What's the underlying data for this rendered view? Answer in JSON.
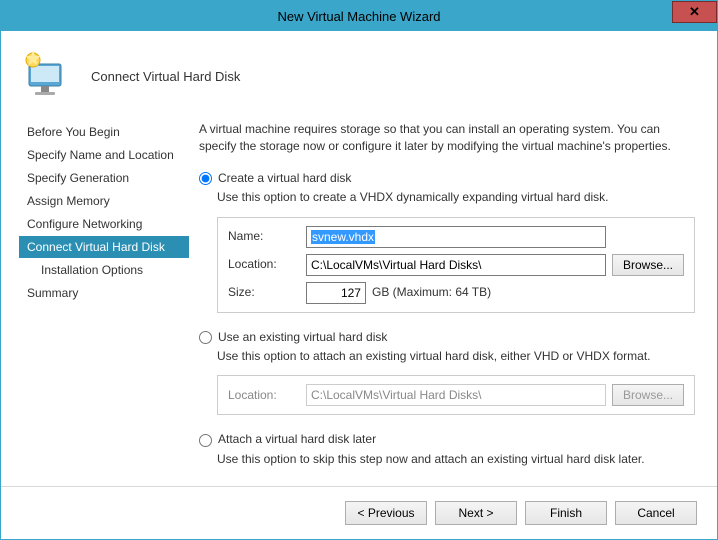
{
  "window": {
    "title": "New Virtual Machine Wizard"
  },
  "header": {
    "title": "Connect Virtual Hard Disk"
  },
  "sidebar": {
    "items": [
      {
        "label": "Before You Begin"
      },
      {
        "label": "Specify Name and Location"
      },
      {
        "label": "Specify Generation"
      },
      {
        "label": "Assign Memory"
      },
      {
        "label": "Configure Networking"
      },
      {
        "label": "Connect Virtual Hard Disk"
      },
      {
        "label": "Installation Options"
      },
      {
        "label": "Summary"
      }
    ]
  },
  "main": {
    "description": "A virtual machine requires storage so that you can install an operating system. You can specify the storage now or configure it later by modifying the virtual machine's properties.",
    "opt_create": {
      "label": "Create a virtual hard disk",
      "sub": "Use this option to create a VHDX dynamically expanding virtual hard disk.",
      "name_label": "Name:",
      "name_value": "svnew.vhdx",
      "location_label": "Location:",
      "location_value": "C:\\LocalVMs\\Virtual Hard Disks\\",
      "browse_label": "Browse...",
      "size_label": "Size:",
      "size_value": "127",
      "size_suffix": "GB (Maximum: 64 TB)"
    },
    "opt_existing": {
      "label": "Use an existing virtual hard disk",
      "sub": "Use this option to attach an existing virtual hard disk, either VHD or VHDX format.",
      "location_label": "Location:",
      "location_value": "C:\\LocalVMs\\Virtual Hard Disks\\",
      "browse_label": "Browse..."
    },
    "opt_later": {
      "label": "Attach a virtual hard disk later",
      "sub": "Use this option to skip this step now and attach an existing virtual hard disk later."
    }
  },
  "footer": {
    "previous": "< Previous",
    "next": "Next >",
    "finish": "Finish",
    "cancel": "Cancel"
  }
}
